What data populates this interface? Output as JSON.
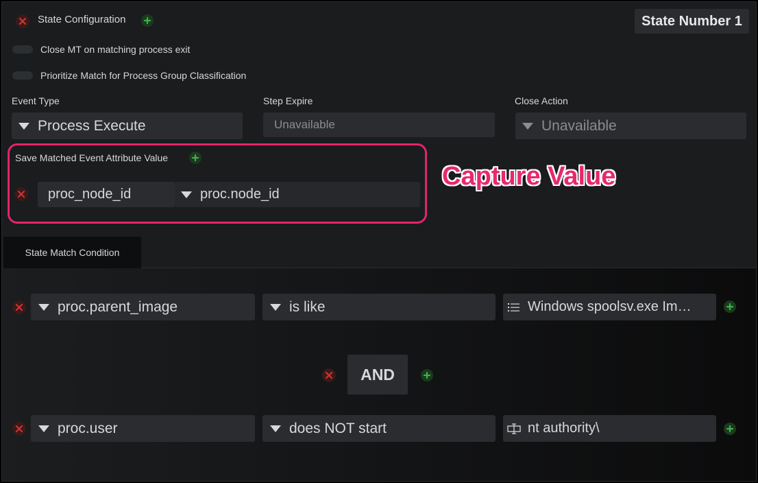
{
  "header": {
    "title": "State Configuration",
    "state_number": "State Number 1"
  },
  "options": [
    {
      "label": "Close MT on matching process exit",
      "enabled": false
    },
    {
      "label": "Prioritize Match for Process Group Classification",
      "enabled": false
    }
  ],
  "fields": {
    "event_type": {
      "label": "Event Type",
      "value": "Process Execute"
    },
    "step_expire": {
      "label": "Step Expire",
      "value": "Unavailable"
    },
    "close_action": {
      "label": "Close Action",
      "value": "Unavailable"
    }
  },
  "save_matched": {
    "label": "Save Matched Event Attribute Value",
    "rows": [
      {
        "name": "proc_node_id",
        "attribute": "proc.node_id"
      }
    ]
  },
  "annotation": "Capture Value",
  "tabs": [
    {
      "label": "State Match Condition",
      "active": true
    }
  ],
  "conditions": [
    {
      "attribute": "proc.parent_image",
      "operator": "is like",
      "value": "Windows spoolsv.exe Im…",
      "value_icon": "list-icon"
    },
    {
      "attribute": "proc.user",
      "operator": "does NOT start",
      "value": "nt authority\\",
      "value_icon": "case-icon"
    }
  ],
  "logic": {
    "operator": "AND"
  },
  "colors": {
    "accent_annotation": "#e8286e",
    "remove": "#c62828",
    "add": "#3aa046",
    "background": "#1a1c1e",
    "field": "#2a2c2f"
  }
}
